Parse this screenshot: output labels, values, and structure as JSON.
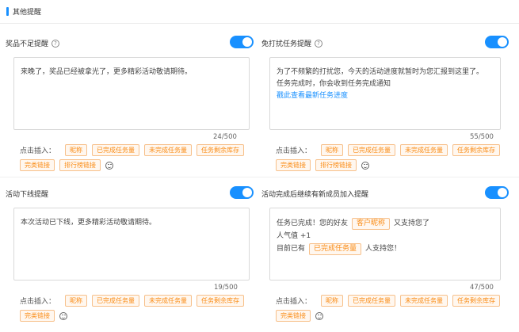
{
  "section": {
    "title": "其他提醒"
  },
  "panels": [
    {
      "title": "奖品不足提醒",
      "has_help": true,
      "text_lines": [
        "来晚了，奖品已经被拿光了，更多精彩活动敬请期待。"
      ],
      "counter": "24/500",
      "insert_label": "点击插入：",
      "chips": [
        "昵称",
        "已完成任务量",
        "未完成任务量",
        "任务剩余库存",
        "完类链接",
        "排行榜链接"
      ]
    },
    {
      "title": "免打扰任务提醒",
      "has_help": true,
      "text_lines": [
        "为了不频繁的打扰您，今天的活动进度就暂时为您汇报到这里了。",
        "任务完成时，你会收到任务完成通知"
      ],
      "link": "戳此查看最新任务进度",
      "counter": "55/500",
      "insert_label": "点击插入：",
      "chips": [
        "昵称",
        "已完成任务量",
        "未完成任务量",
        "任务剩余库存",
        "完类链接",
        "排行榜链接"
      ]
    },
    {
      "title": "活动下线提醒",
      "has_help": false,
      "text_lines": [
        "本次活动已下线，更多精彩活动敬请期待。"
      ],
      "counter": "19/500",
      "insert_label": "点击插入：",
      "chips": [
        "昵称",
        "已完成任务量",
        "未完成任务量",
        "任务剩余库存",
        "完类链接"
      ]
    },
    {
      "title": "活动完成后继续有新成员加入提醒",
      "has_help": false,
      "line1_prefix": "任务已完成！您的好友",
      "line1_chip": "客户昵称",
      "line1_suffix": "又支持您了",
      "line2": "人气值 +1",
      "line3_prefix": "目前已有",
      "line3_chip": "已完成任务量",
      "line3_suffix": "人支持您！",
      "counter": "47/500",
      "insert_label": "点击插入：",
      "chips": [
        "昵称",
        "已完成任务量",
        "未完成任务量",
        "任务剩余库存",
        "完类链接"
      ]
    }
  ]
}
